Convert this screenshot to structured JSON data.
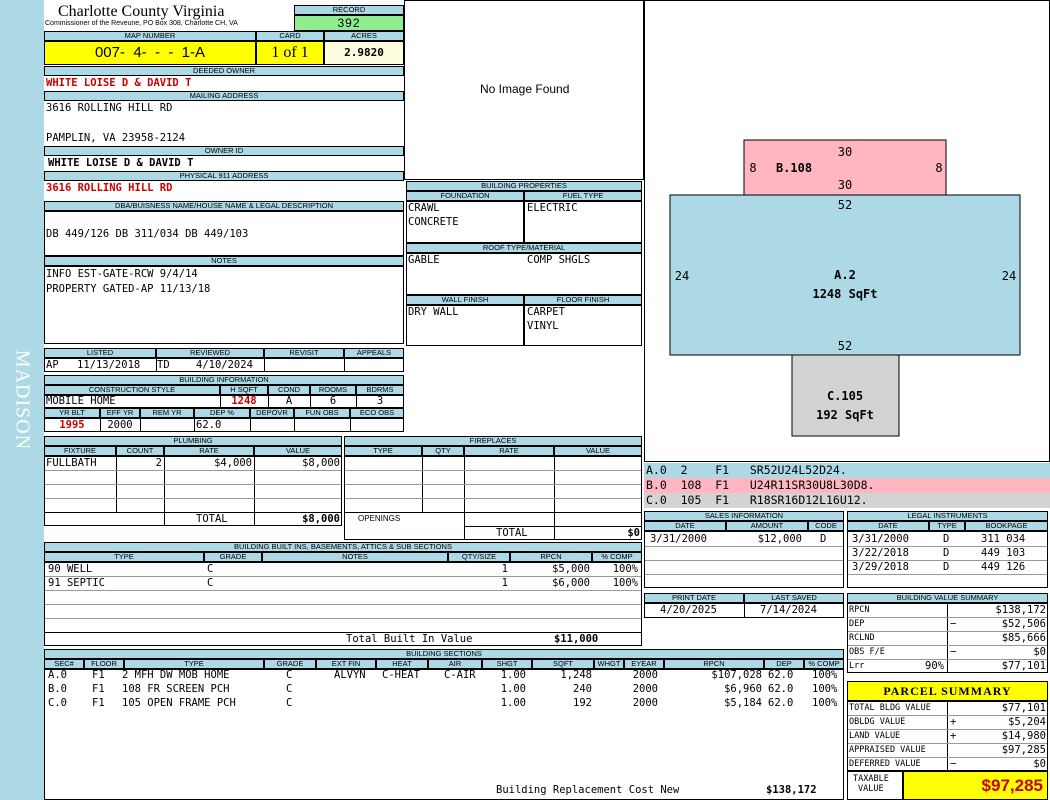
{
  "sidebar": {
    "label": "MADISON"
  },
  "header": {
    "county": "Charlotte County Virginia",
    "commissioner": "Commissioner of the Reveune, PO Box 308, Charlotte CH, VA",
    "record_label": "RECORD",
    "record": "392",
    "map_label": "MAP NUMBER",
    "map_number": "007-  4-  -  -  1-A",
    "card_label": "CARD",
    "card": "1 of 1",
    "acres_label": "ACRES",
    "acres": "2.9820"
  },
  "owner": {
    "deeded_label": "DEEDED OWNER",
    "deeded": "WHITE LOISE D & DAVID T",
    "mailing_label": "MAILING ADDRESS",
    "mail1": "3616 ROLLING HILL RD",
    "mail2": "PAMPLIN, VA 23958-2124",
    "ownerid_label": "OWNER ID",
    "owner_id": "WHITE LOISE D & DAVID T",
    "physical_label": "PHYSICAL 911 ADDRESS",
    "physical": "3616 ROLLING HILL RD",
    "dba_label": "DBA/BUISNESS NAME/HOUSE NAME & LEGAL DESCRIPTION",
    "dba": "DB 449/126 DB 311/034 DB 449/103",
    "notes_label": "NOTES",
    "note1": "INFO EST-GATE-RCW 9/4/14",
    "note2": "PROPERTY GATED-AP 11/13/18"
  },
  "image": {
    "no_image": "No Image Found"
  },
  "building_props": {
    "title": "BUILDING PROPERTIES",
    "foundation_label": "FOUNDATION",
    "fuel_label": "FUEL TYPE",
    "foundation1": "CRAWL",
    "foundation2": "CONCRETE",
    "fuel": "ELECTRIC",
    "roof_label": "ROOF TYPE/MATERIAL",
    "roof_type": "GABLE",
    "roof_material": "COMP SHGLS",
    "wall_label": "WALL FINISH",
    "floor_label": "FLOOR FINISH",
    "wall": "DRY WALL",
    "floor1": "CARPET",
    "floor2": "VINYL"
  },
  "listing": {
    "listed_label": "LISTED",
    "reviewed_label": "REVIEWED",
    "revisit_label": "REVISIT",
    "appeals_label": "APPEALS",
    "listed_by": "AP",
    "listed_date": "11/13/2018",
    "reviewed_by": "TD",
    "reviewed_date": "4/10/2024"
  },
  "building_info": {
    "title": "BUILDING INFORMATION",
    "style_label": "CONSTRUCTION STYLE",
    "hsqft_label": "H SQFT",
    "cond_label": "COND",
    "rooms_label": "ROOMS",
    "bdrms_label": "BDRMS",
    "style": "MOBILE HOME",
    "hsqft": "1248",
    "cond": "A",
    "rooms": "6",
    "bdrms": "3",
    "yrblt_label": "YR BLT",
    "effyr_label": "EFF YR",
    "remyr_label": "REM YR",
    "dep_label": "DEP %",
    "depovr_label": "DEPOVR",
    "funobs_label": "FUN OBS",
    "ecoobs_label": "ECO OBS",
    "yrblt": "1995",
    "effyr": "2000",
    "dep": "62.0"
  },
  "plumbing": {
    "title": "PLUMBING",
    "fixture_label": "FIXTURE",
    "count_label": "COUNT",
    "rate_label": "RATE",
    "value_label": "VALUE",
    "fixture": "FULLBATH",
    "count": "2",
    "rate": "$4,000",
    "value": "$8,000",
    "total_label": "TOTAL",
    "total": "$8,000"
  },
  "fireplaces": {
    "title": "FIREPLACES",
    "type_label": "TYPE",
    "qty_label": "QTY",
    "rate_label": "RATE",
    "value_label": "VALUE",
    "openings_label": "OPENINGS",
    "total_label": "TOTAL",
    "total": "$0"
  },
  "sketch": {
    "b_top": "30",
    "b_bottom": "30",
    "b_left": "8",
    "b_right": "8",
    "b_label": "B.108",
    "a_top": "52",
    "a_bottom": "52",
    "a_left": "24",
    "a_right": "24",
    "a_label": "A.2",
    "a_area": "1248 SqFt",
    "c_label": "C.105",
    "c_area": "192 SqFt",
    "colors": {
      "a": "#add8e6",
      "b": "#ffb6c1",
      "c": "#d3d3d3"
    }
  },
  "sketch_legend": [
    {
      "line": "A.0  2    F1   SR52U24L52D24."
    },
    {
      "line": "B.0  108  F1   U24R11SR30U8L30D8."
    },
    {
      "line": "C.0  105  F1   R18SR16D12L16U12."
    }
  ],
  "sales": {
    "title": "SALES INFORMATION",
    "date_label": "DATE",
    "amount_label": "AMOUNT",
    "code_label": "CODE",
    "rows": [
      {
        "date": "3/31/2000",
        "amount": "$12,000",
        "code": "D"
      }
    ]
  },
  "legal": {
    "title": "LEGAL INSTRUMENTS",
    "date_label": "DATE",
    "type_label": "TYPE",
    "book_label": "BOOKPAGE",
    "rows": [
      {
        "date": "3/31/2000",
        "type": "D",
        "book": "311 034"
      },
      {
        "date": "3/22/2018",
        "type": "D",
        "book": "449 103"
      },
      {
        "date": "3/29/2018",
        "type": "D",
        "book": "449 126"
      }
    ]
  },
  "print": {
    "print_label": "PRINT DATE",
    "saved_label": "LAST SAVED",
    "print_date": "4/20/2025",
    "saved_date": "7/14/2024"
  },
  "builtins": {
    "title": "BUILDING BUILT INS, BASEMENTS, ATTICS & SUB SECTIONS",
    "type_label": "TYPE",
    "grade_label": "GRADE",
    "notes_label": "NOTES",
    "qty_label": "QTY/SIZE",
    "rpcn_label": "RPCN",
    "comp_label": "% COMP",
    "rows": [
      {
        "type": "90 WELL",
        "grade": "C",
        "qty": "1",
        "rpcn": "$5,000",
        "comp": "100%"
      },
      {
        "type": "91 SEPTIC",
        "grade": "C",
        "qty": "1",
        "rpcn": "$6,000",
        "comp": "100%"
      }
    ],
    "total_label": "Total Built In Value",
    "total": "$11,000"
  },
  "sections": {
    "title": "BUILDING SECTIONS",
    "labels": {
      "sec": "SEC#",
      "floor": "FLOOR",
      "type": "TYPE",
      "grade": "GRADE",
      "extfin": "EXT FIN",
      "heat": "HEAT",
      "air": "AIR",
      "shgt": "SHGT",
      "sqft": "SQFT",
      "whgt": "WHGT",
      "eyear": "EYEAR",
      "rpcn": "RPCN",
      "dep": "DEP",
      "comp": "% COMP"
    },
    "rows": [
      {
        "sec": "A.0",
        "floor": "F1",
        "type": "2 MFH DW MOB HOME",
        "grade": "C",
        "extfin": "ALVYN",
        "heat": "C-HEAT",
        "air": "C-AIR",
        "shgt": "1.00",
        "sqft": "1,248",
        "eyear": "2000",
        "rpcn": "$107,028",
        "dep": "62.0",
        "comp": "100%"
      },
      {
        "sec": "B.0",
        "floor": "F1",
        "type": "108 FR SCREEN PCH",
        "grade": "C",
        "extfin": "",
        "heat": "",
        "air": "",
        "shgt": "1.00",
        "sqft": "240",
        "eyear": "2000",
        "rpcn": "$6,960",
        "dep": "62.0",
        "comp": "100%"
      },
      {
        "sec": "C.0",
        "floor": "F1",
        "type": "105 OPEN FRAME PCH",
        "grade": "C",
        "extfin": "",
        "heat": "",
        "air": "",
        "shgt": "1.00",
        "sqft": "192",
        "eyear": "2000",
        "rpcn": "$5,184",
        "dep": "62.0",
        "comp": "100%"
      }
    ],
    "brcn_label": "Building Replacement Cost New",
    "brcn": "$138,172"
  },
  "value_summary": {
    "title": "BUILDING VALUE SUMMARY",
    "rows": [
      {
        "label": "RPCN",
        "pct": "",
        "sign": "",
        "value": "$138,172"
      },
      {
        "label": "DEP",
        "pct": "",
        "sign": "−",
        "value": "$52,506"
      },
      {
        "label": "RCLND",
        "pct": "",
        "sign": "",
        "value": "$85,666"
      },
      {
        "label": "OBS F/E",
        "pct": "",
        "sign": "−",
        "value": "$0"
      },
      {
        "label": "Lrr",
        "pct": "90%",
        "sign": "",
        "value": "$77,101"
      }
    ]
  },
  "parcel": {
    "title": "PARCEL SUMMARY",
    "rows": [
      {
        "label": "TOTAL BLDG VALUE",
        "sign": "",
        "value": "$77,101"
      },
      {
        "label": "OBLDG VALUE",
        "sign": "+",
        "value": "$5,204"
      },
      {
        "label": "LAND VALUE",
        "sign": "+",
        "value": "$14,980"
      },
      {
        "label": "APPRAISED VALUE",
        "sign": "",
        "value": "$97,285"
      },
      {
        "label": "DEFERRED VALUE",
        "sign": "−",
        "value": "$0"
      }
    ],
    "taxable_label1": "TAXABLE",
    "taxable_label2": "VALUE",
    "taxable": "$97,285"
  }
}
